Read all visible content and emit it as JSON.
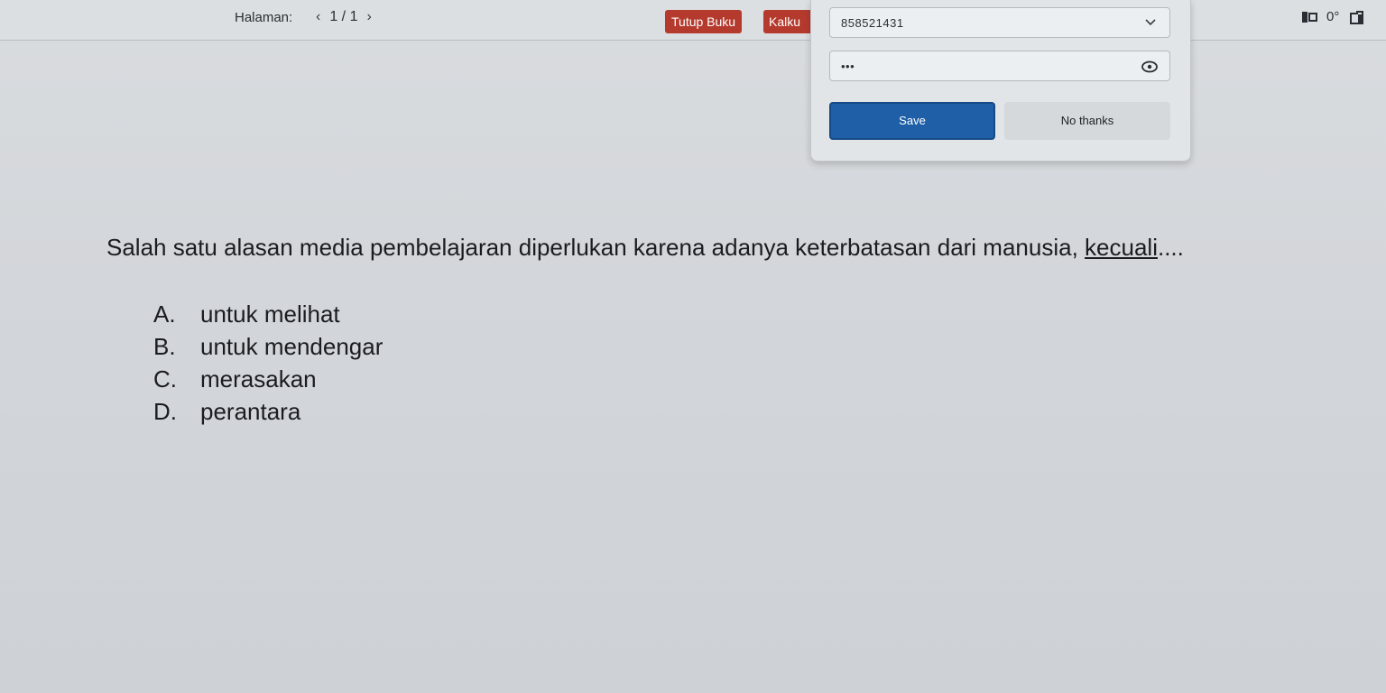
{
  "toolbar": {
    "page_label": "Halaman:",
    "page_indicator": "1 / 1",
    "prev_icon": "chevron-left-icon",
    "next_icon": "chevron-right-icon",
    "close_book_label": "Tutup Buku",
    "calculator_label": "Kalku",
    "status_text": "0°",
    "colors": {
      "red_button": "#b53a2e"
    }
  },
  "password_popup": {
    "username_value": "858521431",
    "password_value": "•••",
    "save_label": "Save",
    "no_thanks_label": "No thanks",
    "colors": {
      "save_button": "#1f5fa8"
    }
  },
  "question": {
    "text_before": "Salah satu alasan media pembelajaran diperlukan karena adanya keterbatasan dari manusia, ",
    "text_underlined": "kecuali",
    "text_after": "....",
    "options": [
      {
        "letter": "A.",
        "text": "untuk melihat"
      },
      {
        "letter": "B.",
        "text": "untuk mendengar"
      },
      {
        "letter": "C.",
        "text": "merasakan"
      },
      {
        "letter": "D.",
        "text": "perantara"
      }
    ]
  }
}
